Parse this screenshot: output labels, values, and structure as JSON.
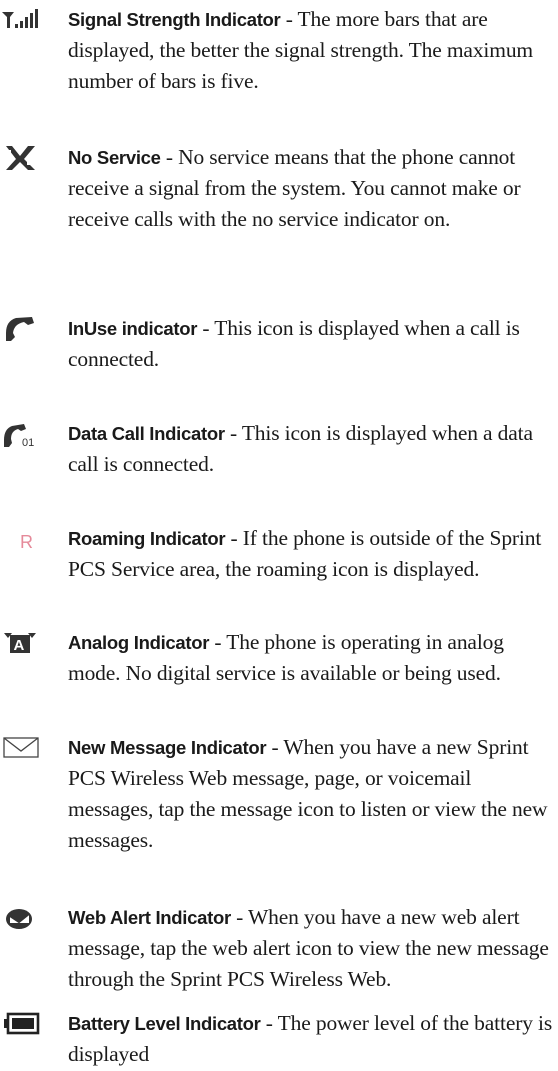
{
  "indicators": [
    {
      "term": "Signal Strength Indicator",
      "separator": " - ",
      "description": "The more bars that are displayed, the better the signal strength. The maximum number of bars is five.",
      "icon": "signal-strength-icon"
    },
    {
      "term": "No Service",
      "separator": " - ",
      "description": "No service means that the phone cannot receive a signal from the system. You cannot make or receive calls with the no service indicator on.",
      "icon": "no-service-icon"
    },
    {
      "term": "InUse indicator",
      "separator": " - ",
      "description": "This icon is displayed when a call is connected.",
      "icon": "in-use-handset-icon"
    },
    {
      "term": "Data Call Indicator",
      "separator": " - ",
      "description": "This icon is displayed when a data call is connected.",
      "icon": "data-call-handset-icon",
      "icon_label": "01"
    },
    {
      "term": "Roaming Indicator",
      "separator": " - ",
      "description": "If the phone is outside of the Sprint PCS Service area, the roaming icon is displayed.",
      "icon": "roaming-icon",
      "icon_label": "R",
      "icon_color": "#e58a9a"
    },
    {
      "term": "Analog Indicator",
      "separator": " - ",
      "description": "The phone is operating in analog mode. No digital service is available or being used.",
      "icon": "analog-icon",
      "icon_label": "A"
    },
    {
      "term": "New Message Indicator",
      "separator": " - ",
      "description": "When you have a new Sprint PCS Wireless Web message, page, or voicemail messages, tap the message icon to listen or view the new messages.",
      "icon": "envelope-icon"
    },
    {
      "term": "Web Alert Indicator",
      "separator": " - ",
      "description": "When you have a new web alert message, tap the web alert icon to view the new message through the Sprint PCS Wireless Web.",
      "icon": "web-alert-icon"
    },
    {
      "term": "Battery Level Indicator",
      "separator": " - ",
      "description": "The power level of the battery is displayed",
      "icon": "battery-icon"
    }
  ]
}
